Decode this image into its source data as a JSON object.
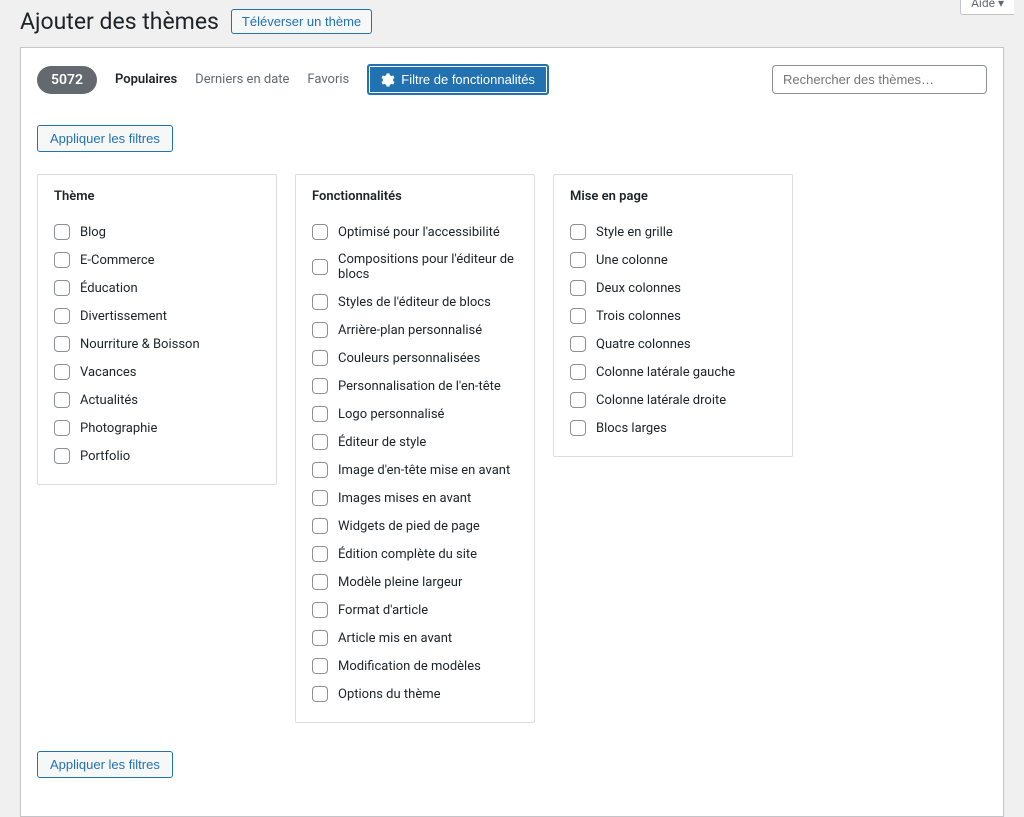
{
  "header": {
    "title": "Ajouter des thèmes",
    "upload_label": "Téléverser un thème",
    "help_label": "Aide"
  },
  "toolbar": {
    "count": "5072",
    "tab_popular": "Populaires",
    "tab_latest": "Derniers en date",
    "tab_favorites": "Favoris",
    "feature_filter_label": "Filtre de fonctionnalités",
    "search_placeholder": "Rechercher des thèmes…"
  },
  "apply_filters_label": "Appliquer les filtres",
  "columns": {
    "theme": {
      "heading": "Thème",
      "items": [
        "Blog",
        "E-Commerce",
        "Éducation",
        "Divertissement",
        "Nourriture & Boisson",
        "Vacances",
        "Actualités",
        "Photographie",
        "Portfolio"
      ]
    },
    "features": {
      "heading": "Fonctionnalités",
      "items": [
        "Optimisé pour l'accessibilité",
        "Compositions pour l'éditeur de blocs",
        "Styles de l'éditeur de blocs",
        "Arrière-plan personnalisé",
        "Couleurs personnalisées",
        "Personnalisation de l'en-tête",
        "Logo personnalisé",
        "Éditeur de style",
        "Image d'en-tête mise en avant",
        "Images mises en avant",
        "Widgets de pied de page",
        "Édition complète du site",
        "Modèle pleine largeur",
        "Format d'article",
        "Article mis en avant",
        "Modification de modèles",
        "Options du thème"
      ]
    },
    "layout": {
      "heading": "Mise en page",
      "items": [
        "Style en grille",
        "Une colonne",
        "Deux colonnes",
        "Trois colonnes",
        "Quatre colonnes",
        "Colonne latérale gauche",
        "Colonne latérale droite",
        "Blocs larges"
      ]
    }
  }
}
